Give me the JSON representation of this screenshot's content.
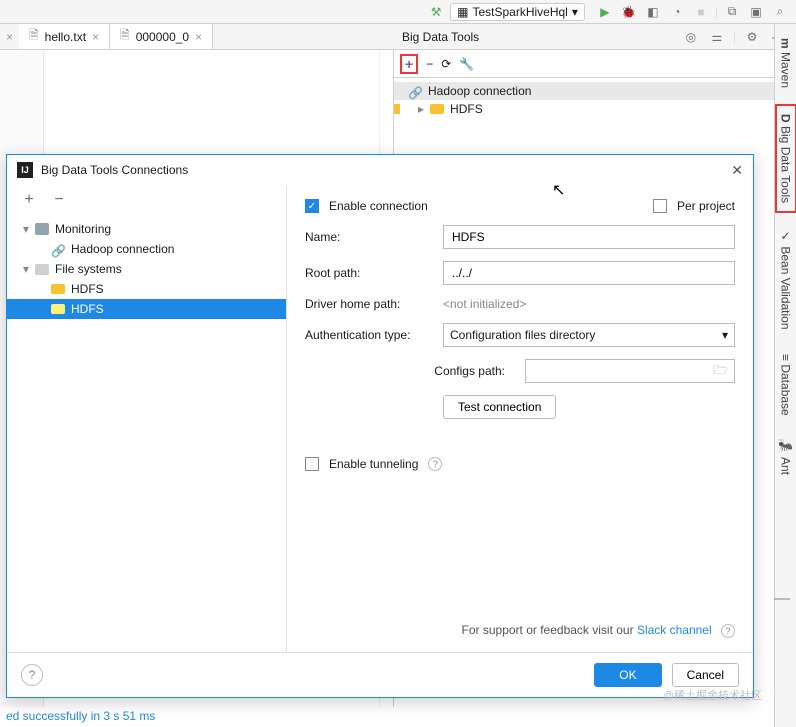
{
  "toolbar": {
    "run_config": "TestSparkHiveHql"
  },
  "tabs": {
    "editor": [
      {
        "name": "hello.txt"
      },
      {
        "name": "000000_0"
      }
    ],
    "tool_title": "Big Data Tools"
  },
  "tool_tree": {
    "root": "Hadoop connection",
    "child": "HDFS"
  },
  "right_rail": {
    "maven": "Maven",
    "bigdata": "Big Data Tools",
    "bean": "Bean Validation",
    "database": "Database",
    "ant": "Ant"
  },
  "dialog": {
    "title": "Big Data Tools Connections",
    "left": {
      "monitoring": "Monitoring",
      "hadoop": "Hadoop connection",
      "filesystems": "File systems",
      "hdfs1": "HDFS",
      "hdfs2": "HDFS"
    },
    "right": {
      "enable_label": "Enable connection",
      "per_project_label": "Per project",
      "name_label": "Name:",
      "name_value": "HDFS",
      "root_label": "Root path:",
      "root_value": "../../",
      "driver_label": "Driver home path:",
      "driver_value": "<not initialized>",
      "auth_label": "Authentication type:",
      "auth_value": "Configuration files directory",
      "configs_label": "Configs path:",
      "test_btn": "Test connection",
      "tunnel_label": "Enable tunneling",
      "support_prefix": "For support or feedback visit our ",
      "support_link": "Slack channel"
    },
    "footer": {
      "ok": "OK",
      "cancel": "Cancel"
    }
  },
  "status": "ed successfully in 3 s 51 ms",
  "watermark": "@稀土掘金技术社区"
}
